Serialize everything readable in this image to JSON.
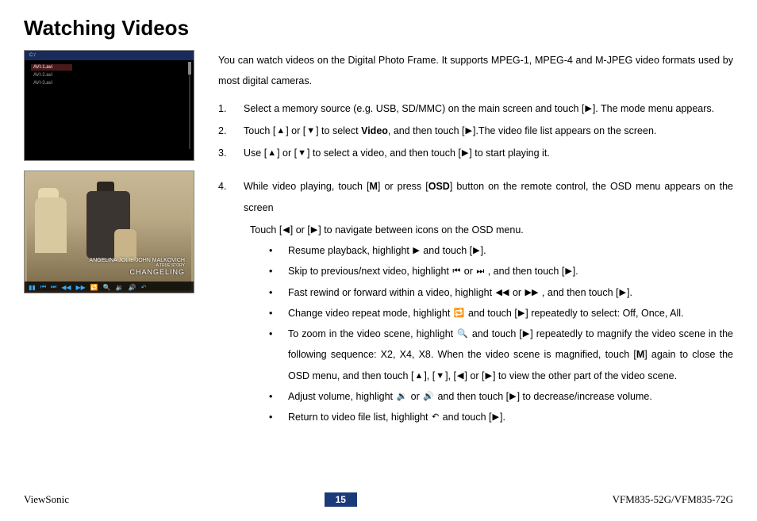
{
  "title": "Watching Videos",
  "thumb1": {
    "drive_label": "C:/",
    "files": [
      "AVI-1.avi",
      "AVI-2.avi",
      "AVI-3.avi"
    ]
  },
  "thumb2": {
    "caption_line1": "ANGELINA JOLIE   JOHN MALKOVICH",
    "caption_line2": "A TRUE STORY",
    "caption_title": "CHANGELING"
  },
  "intro": "You can watch videos on the Digital Photo Frame. It supports MPEG-1, MPEG-4 and M-JPEG video formats used by most digital cameras.",
  "steps": [
    {
      "num": "1.",
      "pre": "Select a memory source (e.g. USB, SD/MMC) on the main screen and touch [",
      "icon": "▶",
      "post": "]. The mode menu appears."
    },
    {
      "num": "2.",
      "t1": "Touch [",
      "i1": "▲",
      "t2": "] or [",
      "i2": "▼",
      "t3": "] to select ",
      "bold": "Video",
      "t4": ", and then touch [",
      "i3": "▶",
      "t5": "].The video file list appears on the screen."
    },
    {
      "num": "3.",
      "t1": "Use [",
      "i1": "▲",
      "t2": "] or [",
      "i2": "▼",
      "t3": "] to select a video, and then touch [",
      "i3": "▶",
      "t4": "] to start playing it."
    }
  ],
  "step4": {
    "num": "4.",
    "t1": "While video playing, touch [",
    "b1": "M",
    "t2": "] or press [",
    "b2": "OSD",
    "t3": "] button on the remote control, the OSD menu appears on the screen"
  },
  "subline": {
    "t1": "Touch [",
    "i1": "◀",
    "t2": "] or [",
    "i2": "▶",
    "t3": "] to navigate between icons on the OSD menu."
  },
  "bullets": [
    {
      "t1": "Resume playback, highlight ",
      "ic1": "▶",
      "t2": " and touch [",
      "ic2": "▶",
      "t3": "]."
    },
    {
      "t1": "Skip to previous/next video, highlight ",
      "ic1": "⏮",
      "t2": " or ",
      "ic2": "⏭",
      "t3": " , and then touch [",
      "ic3": "▶",
      "t4": "]."
    },
    {
      "t1": "Fast rewind or forward within a video, highlight ",
      "ic1": "◀◀",
      "t2": " or ",
      "ic2": "▶▶",
      "t3": " , and then touch [",
      "ic3": "▶",
      "t4": "]."
    },
    {
      "t1": "Change video repeat mode, highlight ",
      "ic1": "🔁",
      "t2": " and touch [",
      "ic2": "▶",
      "t3": "] repeatedly to select: Off, Once, All."
    },
    {
      "t1": "To zoom in the video scene, highlight ",
      "ic1": "🔍",
      "t2": " and touch [",
      "ic2": "▶",
      "t3": "] repeatedly to magnify the video scene in the following sequence: X2, X4, X8. When the video scene is magnified, touch [",
      "b1": "M",
      "t4": "] again to close the OSD menu, and then touch [",
      "ic3": "▲",
      "t5": "], [",
      "ic4": "▼",
      "t6": "], [",
      "ic5": "◀",
      "t7": "] or [",
      "ic6": "▶",
      "t8": "] to view the other part of the video scene."
    },
    {
      "t1": "Adjust volume, highlight ",
      "ic1": "🔉",
      "t2": " or ",
      "ic2": "🔊",
      "t3": " and then touch [",
      "ic3": "▶",
      "t4": "] to decrease/increase volume."
    },
    {
      "t1": "Return to video file list, highlight ",
      "ic1": "↶",
      "t2": " and touch [",
      "ic2": "▶",
      "t3": "]."
    }
  ],
  "footer": {
    "brand": "ViewSonic",
    "page": "15",
    "model": "VFM835-52G/VFM835-72G"
  }
}
